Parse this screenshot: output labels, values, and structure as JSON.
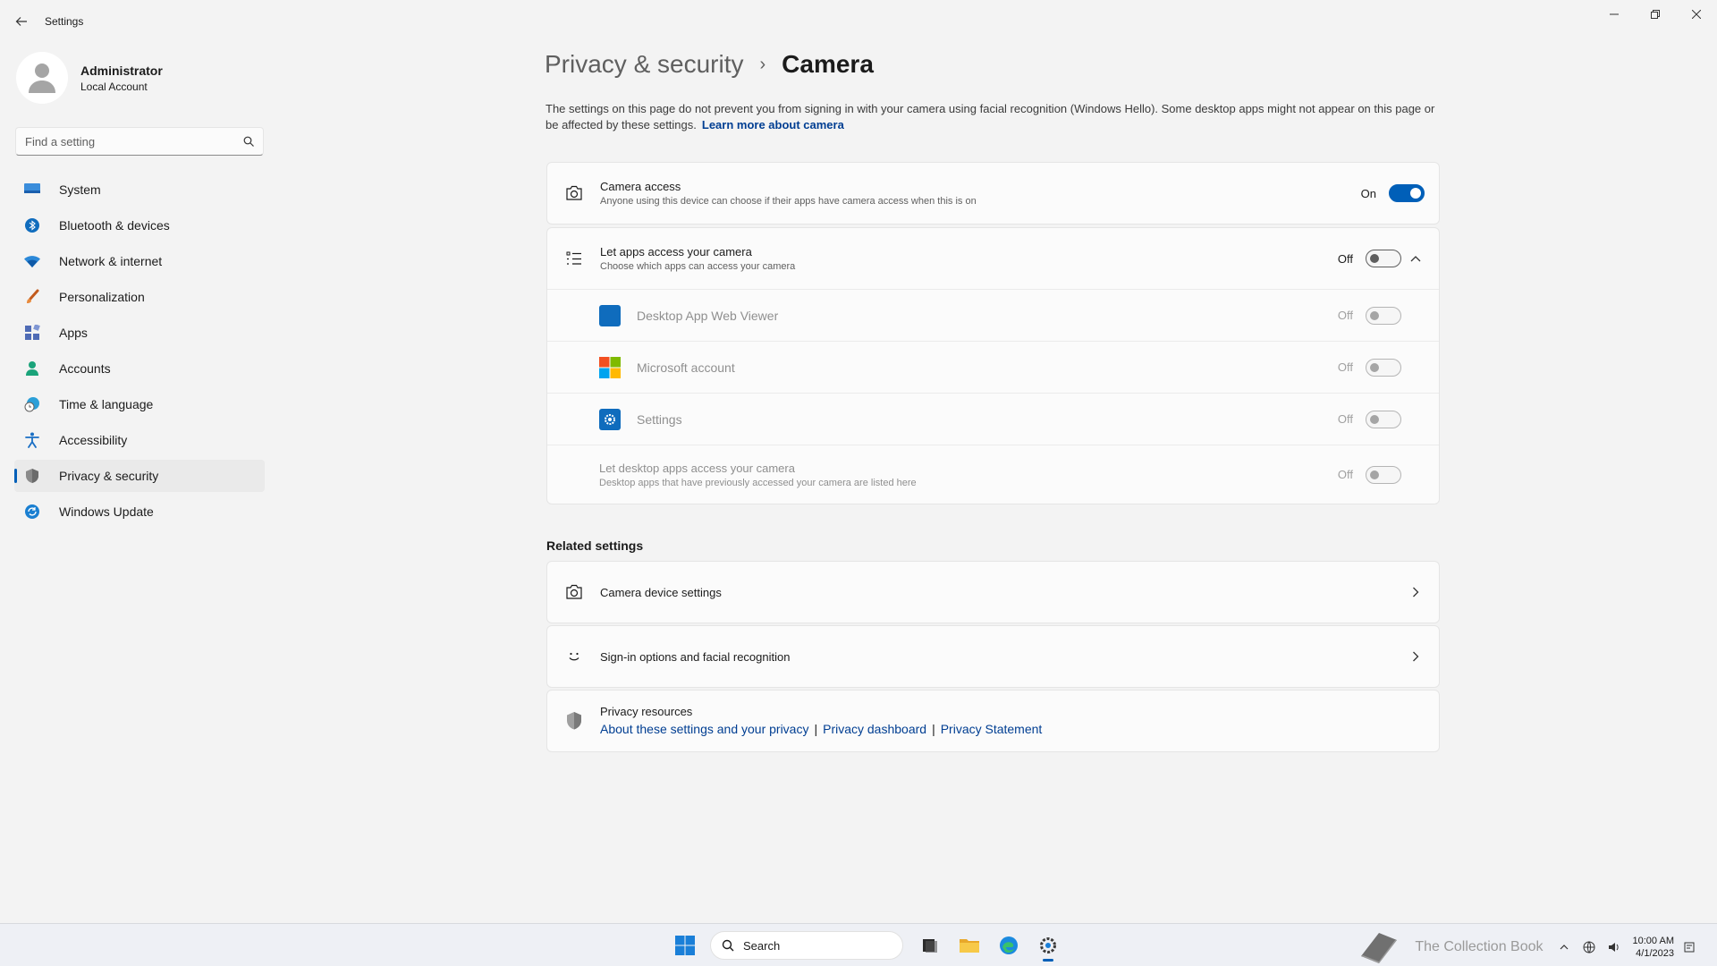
{
  "window": {
    "title": "Settings"
  },
  "profile": {
    "name": "Administrator",
    "account_type": "Local Account"
  },
  "search": {
    "placeholder": "Find a setting"
  },
  "nav": [
    {
      "label": "System",
      "icon": "monitor-icon"
    },
    {
      "label": "Bluetooth & devices",
      "icon": "bluetooth-icon"
    },
    {
      "label": "Network & internet",
      "icon": "wifi-icon"
    },
    {
      "label": "Personalization",
      "icon": "brush-icon"
    },
    {
      "label": "Apps",
      "icon": "apps-icon"
    },
    {
      "label": "Accounts",
      "icon": "person-icon"
    },
    {
      "label": "Time & language",
      "icon": "clock-globe-icon"
    },
    {
      "label": "Accessibility",
      "icon": "accessibility-icon"
    },
    {
      "label": "Privacy & security",
      "icon": "shield-icon",
      "active": true
    },
    {
      "label": "Windows Update",
      "icon": "update-icon"
    }
  ],
  "breadcrumb": {
    "parent": "Privacy & security",
    "separator": "›",
    "current": "Camera"
  },
  "intro": {
    "text": "The settings on this page do not prevent you from signing in with your camera using facial recognition (Windows Hello). Some desktop apps might not appear on this page or be affected by these settings.",
    "link": "Learn more about camera"
  },
  "camera_access": {
    "title": "Camera access",
    "subtitle": "Anyone using this device can choose if their apps have camera access when this is on",
    "state": "On"
  },
  "apps_access": {
    "title": "Let apps access your camera",
    "subtitle": "Choose which apps can access your camera",
    "state": "Off",
    "apps": [
      {
        "name": "Desktop App Web Viewer",
        "state": "Off",
        "color": "#0f6cbd"
      },
      {
        "name": "Microsoft account",
        "state": "Off",
        "color": "#f25022"
      },
      {
        "name": "Settings",
        "state": "Off",
        "color": "#0f6cbd"
      }
    ],
    "desktop": {
      "title": "Let desktop apps access your camera",
      "subtitle": "Desktop apps that have previously accessed your camera are listed here",
      "state": "Off"
    }
  },
  "related": {
    "heading": "Related settings",
    "camera_device": "Camera device settings",
    "signin": "Sign-in options and facial recognition",
    "privacy_resources": {
      "title": "Privacy resources",
      "links": [
        "About these settings and your privacy",
        "Privacy dashboard",
        "Privacy Statement"
      ],
      "separator": "|"
    }
  },
  "taskbar": {
    "search_label": "Search",
    "watermark": "The Collection Book",
    "time": "10:00 AM",
    "date": "4/1/2023"
  },
  "colors": {
    "accent": "#005fb8",
    "link": "#003e92"
  }
}
